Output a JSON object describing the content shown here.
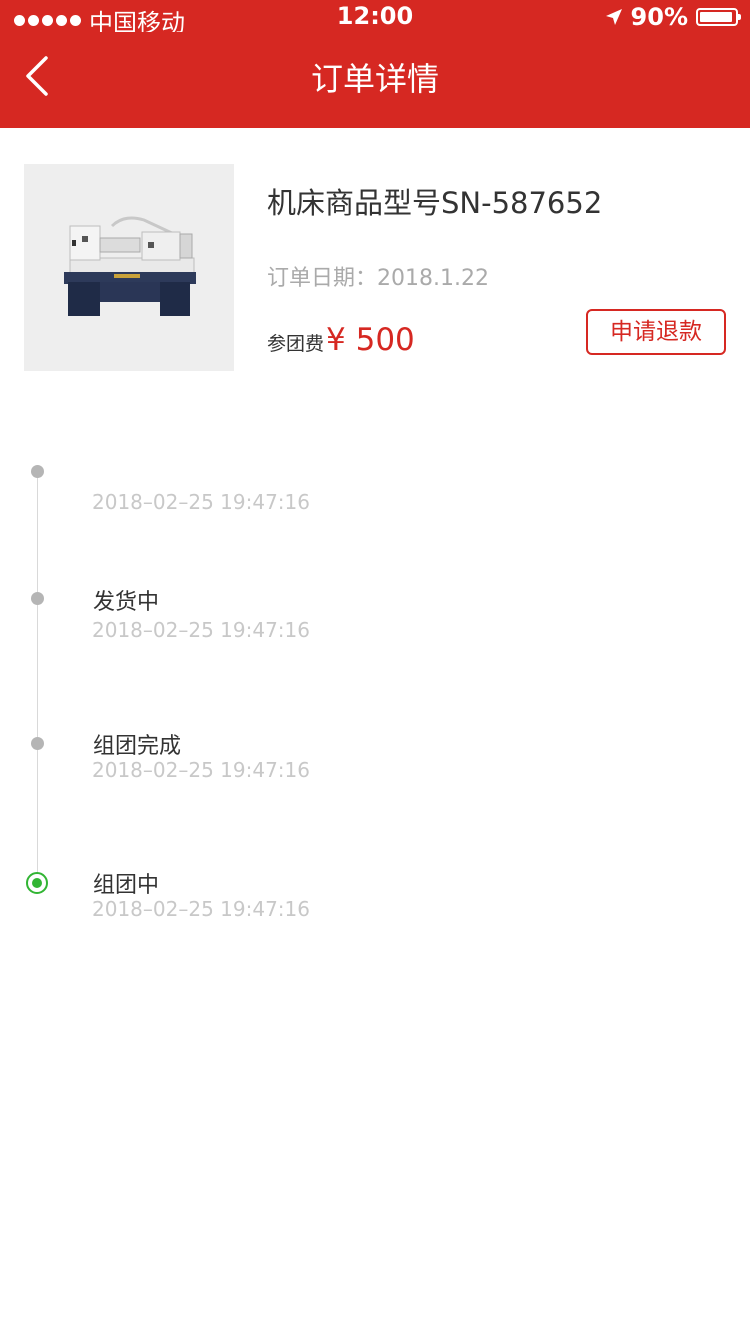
{
  "status_bar": {
    "carrier": "中国移动",
    "time": "12:00",
    "battery": "90%"
  },
  "nav": {
    "title": "订单详情"
  },
  "product": {
    "name": "机床商品型号SN-587652",
    "date_label": "订单日期：",
    "date_value": "2018.1.22",
    "fee_label": "参团费",
    "fee_amount": "¥ 500",
    "refund_button": "申请退款"
  },
  "timeline": [
    {
      "title": "",
      "time": "2018–02–25 19:47:16",
      "active": false
    },
    {
      "title": "发货中",
      "time": "2018–02–25 19:47:16",
      "active": false
    },
    {
      "title": "组团完成",
      "time": "2018–02–25 19:47:16",
      "active": false
    },
    {
      "title": "组团中",
      "time": "2018–02–25 19:47:16",
      "active": true
    }
  ],
  "colors": {
    "brand_red": "#d62822",
    "active_green": "#32b534"
  }
}
